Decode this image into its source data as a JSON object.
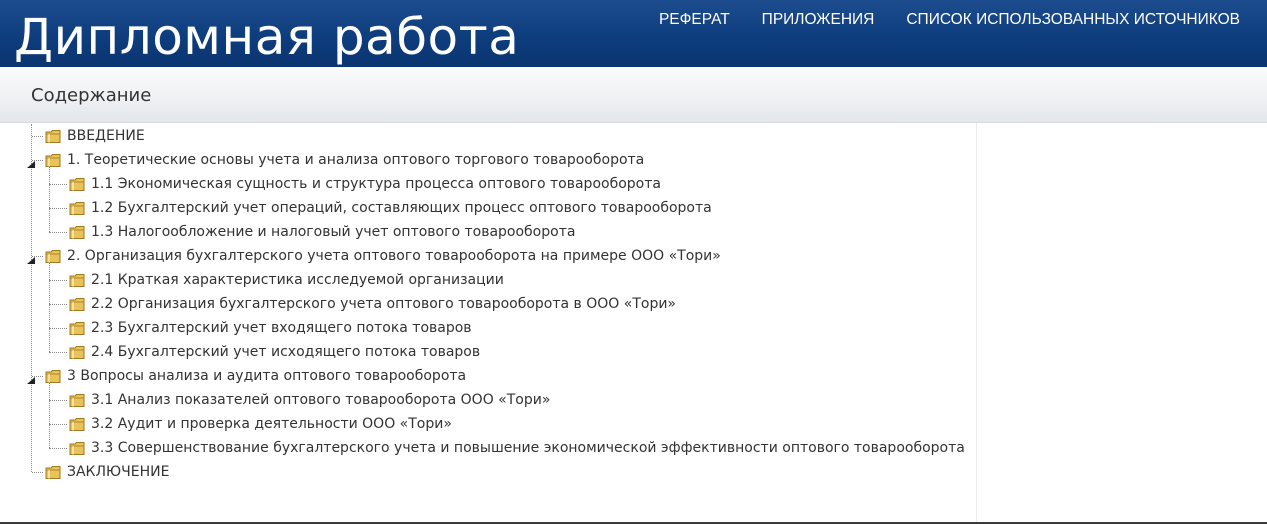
{
  "header": {
    "site_title": "Дипломная работа",
    "nav": [
      {
        "label": "РЕФЕРАТ"
      },
      {
        "label": "ПРИЛОЖЕНИЯ"
      },
      {
        "label": "СПИСОК ИСПОЛЬЗОВАННЫХ ИСТОЧНИКОВ"
      }
    ]
  },
  "section": {
    "title": "Содержание"
  },
  "tree": {
    "icon": "folder-icon",
    "expander_icon": "expanded-triangle-icon",
    "items": [
      {
        "label": "ВВЕДЕНИЕ",
        "level": 0,
        "expanded": false
      },
      {
        "label": "1. Теоретические основы учета и анализа оптового торгового товарооборота",
        "level": 0,
        "expanded": true
      },
      {
        "label": "1.1 Экономическая сущность и структура процесса оптового товарооборота",
        "level": 1
      },
      {
        "label": "1.2 Бухгалтерский учет операций, составляющих процесс оптового товарооборота",
        "level": 1
      },
      {
        "label": "1.3 Налогообложение и налоговый учет оптового товарооборота",
        "level": 1
      },
      {
        "label": "2. Организация бухгалтерского учета оптового товарооборота на примере ООО «Тори»",
        "level": 0,
        "expanded": true
      },
      {
        "label": "2.1 Краткая характеристика исследуемой организации",
        "level": 1
      },
      {
        "label": "2.2 Организация бухгалтерского учета оптового товарооборота в ООО «Тори»",
        "level": 1
      },
      {
        "label": "2.3 Бухгалтерский учет входящего потока товаров",
        "level": 1
      },
      {
        "label": "2.4 Бухгалтерский учет исходящего потока товаров",
        "level": 1
      },
      {
        "label": "3 Вопросы анализа и аудита оптового товарооборота",
        "level": 0,
        "expanded": true
      },
      {
        "label": "3.1 Анализ показателей оптового товарооборота ООО «Тори»",
        "level": 1
      },
      {
        "label": "3.2 Аудит и проверка деятельности ООО «Тори»",
        "level": 1
      },
      {
        "label": "3.3 Совершенствование бухгалтерского учета и повышение экономической эффективности оптового товарооборота",
        "level": 1
      },
      {
        "label": "ЗАКЛЮЧЕНИЕ",
        "level": 0,
        "expanded": false
      }
    ]
  },
  "colors": {
    "header_bg": "#0e3d7e",
    "text": "#333333",
    "folder_fill": "#e8c25a",
    "folder_stroke": "#a07a1e"
  }
}
